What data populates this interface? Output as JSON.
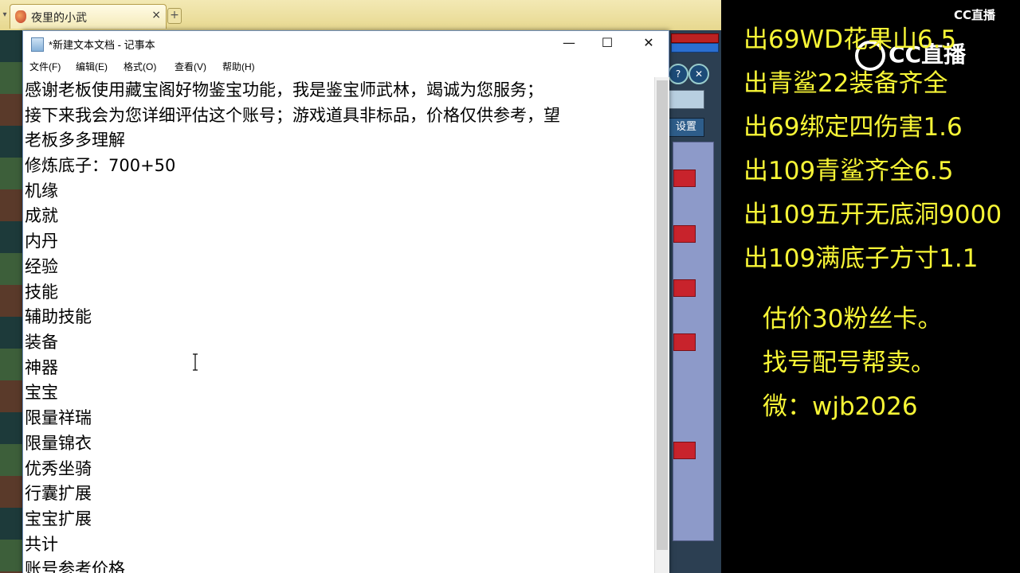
{
  "browser": {
    "tab_title": "夜里的小武",
    "tab_close": "×",
    "new_tab": "+"
  },
  "game": {
    "settings_label": "设置",
    "close_glyph": "✕"
  },
  "notepad": {
    "window_title": "*新建文本文档 - 记事本",
    "controls": {
      "minimize": "—",
      "maximize": "☐",
      "close": "✕"
    },
    "menu": [
      "文件(F)",
      "编辑(E)",
      "格式(O)",
      "查看(V)",
      "帮助(H)"
    ],
    "lines": [
      "感谢老板使用藏宝阁好物鉴宝功能，我是鉴宝师武林，竭诚为您服务；",
      "接下来我会为您详细评估这个账号；游戏道具非标品，价格仅供参考，望",
      "老板多多理解",
      "修炼底子：700+50",
      "机缘",
      "成就",
      "内丹",
      "经验",
      "技能",
      "辅助技能",
      "装备",
      "神器",
      "宝宝",
      "限量祥瑞",
      "限量锦衣",
      "优秀坐骑",
      "行囊扩展",
      "宝宝扩展",
      "共计",
      "账号参考价格"
    ]
  },
  "overlay": {
    "brand_small": "CC直播",
    "brand_big": "CC直播",
    "ads": [
      "出69WD花果山6.5",
      "出青鲨22装备齐全",
      "出69绑定四伤害1.6",
      "出109青鲨齐全6.5",
      "出109五开无底洞9000",
      "出109满底子方寸1.1"
    ],
    "info": [
      "估价30粉丝卡。",
      "找号配号帮卖。",
      "微：wjb2026"
    ]
  },
  "colors": {
    "overlay_text": "#f7f536",
    "overlay_bg": "#000000"
  }
}
